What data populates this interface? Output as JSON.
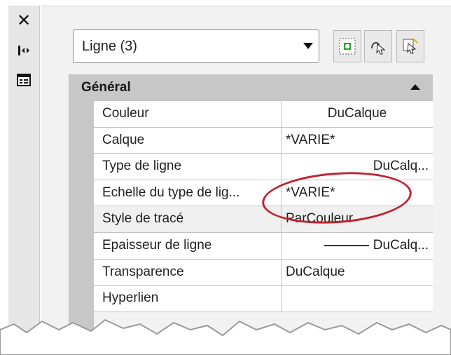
{
  "selector": {
    "value": "Ligne (3)"
  },
  "toolbar": {
    "btn1": "add-selection-icon",
    "btn2": "quick-select-icon",
    "btn3": "select-objects-icon"
  },
  "section": {
    "label": "Général"
  },
  "rows": [
    {
      "label": "Couleur",
      "value": "DuCalque",
      "align": "center"
    },
    {
      "label": "Calque",
      "value": "*VARIE*",
      "align": "left"
    },
    {
      "label": "Type de ligne",
      "value": "DuCalq...",
      "align": "right"
    },
    {
      "label": "Echelle du type de lig...",
      "value": "*VARIE*",
      "align": "left"
    },
    {
      "label": "Style de tracé",
      "value": "ParCouleur",
      "align": "left"
    },
    {
      "label": "Epaisseur de ligne",
      "value": "DuCalq...",
      "align": "right"
    },
    {
      "label": "Transparence",
      "value": "DuCalque",
      "align": "left"
    },
    {
      "label": "Hyperlien",
      "value": "",
      "align": "left"
    }
  ],
  "colors": {
    "accent_annotation": "#c0242f",
    "section_bg": "#c7c7c7"
  }
}
